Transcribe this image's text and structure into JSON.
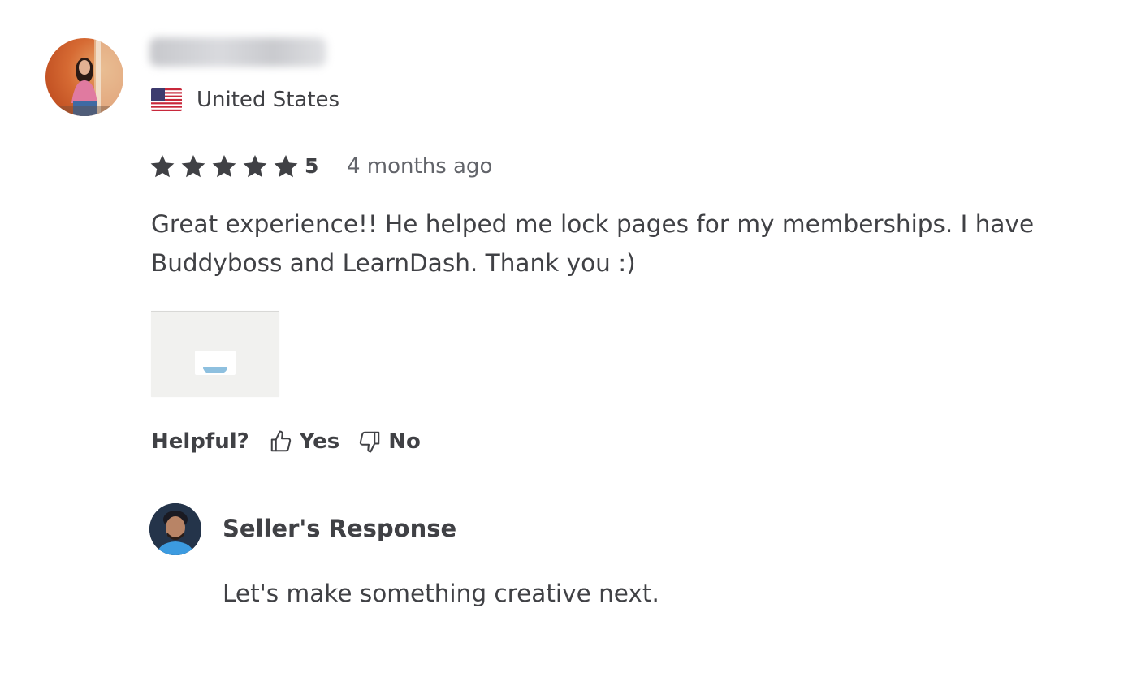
{
  "reviewer": {
    "country": "United States",
    "flag_icon": "us-flag-icon"
  },
  "rating": {
    "stars": 5,
    "value": "5",
    "time_ago": "4 months ago",
    "star_color": "#404145"
  },
  "review": {
    "text": "Great experience!! He helped me lock pages for my memberships. I have Buddyboss and LearnDash. Thank you :)"
  },
  "helpful": {
    "label": "Helpful?",
    "yes_label": "Yes",
    "no_label": "No"
  },
  "seller_response": {
    "title": "Seller's Response",
    "text": "Let's make something creative next."
  }
}
